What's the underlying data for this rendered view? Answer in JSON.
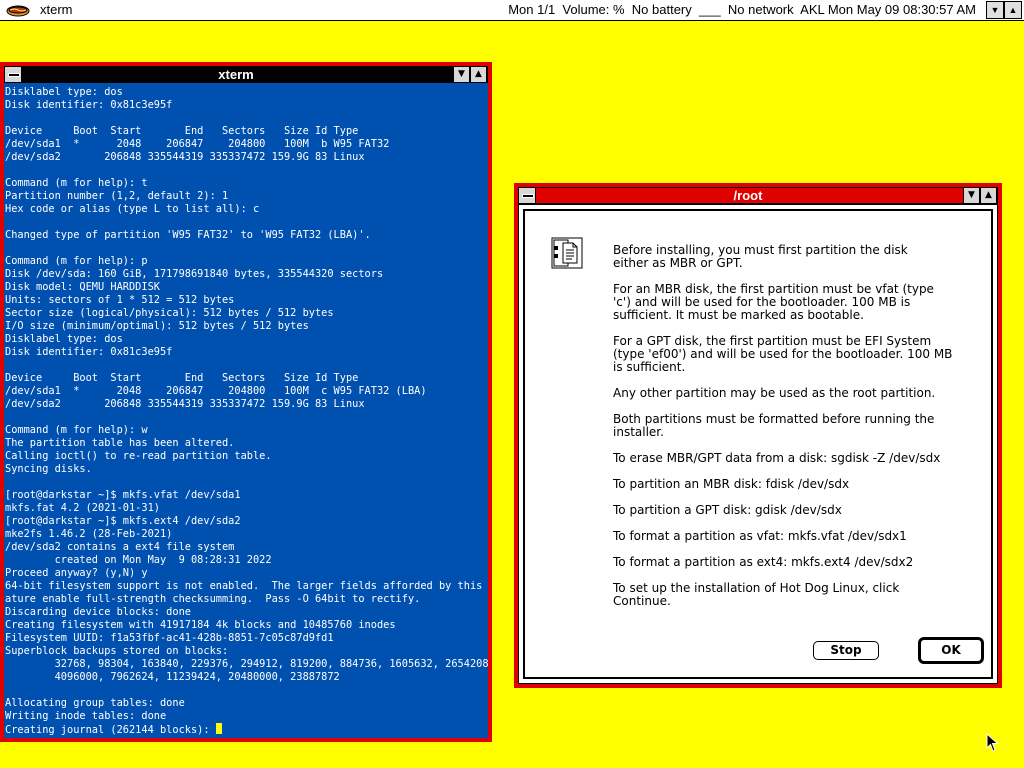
{
  "menubar": {
    "app_name": "xterm",
    "status": "Mon 1/1  Volume: %  No battery  ___  No network  AKL Mon May 09 08:30:57 AM",
    "colors": {
      "desktop": "#ffff00",
      "window_frame": "#e00000",
      "term_bg": "#0050b0"
    }
  },
  "xterm": {
    "title": "xterm",
    "lines": [
      "Disklabel type: dos",
      "Disk identifier: 0x81c3e95f",
      "",
      "Device     Boot  Start       End   Sectors   Size Id Type",
      "/dev/sda1  *      2048    206847    204800   100M  b W95 FAT32",
      "/dev/sda2       206848 335544319 335337472 159.9G 83 Linux",
      "",
      "Command (m for help): t",
      "Partition number (1,2, default 2): 1",
      "Hex code or alias (type L to list all): c",
      "",
      "Changed type of partition 'W95 FAT32' to 'W95 FAT32 (LBA)'.",
      "",
      "Command (m for help): p",
      "Disk /dev/sda: 160 GiB, 171798691840 bytes, 335544320 sectors",
      "Disk model: QEMU HARDDISK",
      "Units: sectors of 1 * 512 = 512 bytes",
      "Sector size (logical/physical): 512 bytes / 512 bytes",
      "I/O size (minimum/optimal): 512 bytes / 512 bytes",
      "Disklabel type: dos",
      "Disk identifier: 0x81c3e95f",
      "",
      "Device     Boot  Start       End   Sectors   Size Id Type",
      "/dev/sda1  *      2048    206847    204800   100M  c W95 FAT32 (LBA)",
      "/dev/sda2       206848 335544319 335337472 159.9G 83 Linux",
      "",
      "Command (m for help): w",
      "The partition table has been altered.",
      "Calling ioctl() to re-read partition table.",
      "Syncing disks.",
      "",
      "[root@darkstar ~]$ mkfs.vfat /dev/sda1",
      "mkfs.fat 4.2 (2021-01-31)",
      "[root@darkstar ~]$ mkfs.ext4 /dev/sda2",
      "mke2fs 1.46.2 (28-Feb-2021)",
      "/dev/sda2 contains a ext4 file system",
      "        created on Mon May  9 08:28:31 2022",
      "Proceed anyway? (y,N) y",
      "64-bit filesystem support is not enabled.  The larger fields afforded by this fe",
      "ature enable full-strength checksumming.  Pass -O 64bit to rectify.",
      "Discarding device blocks: done",
      "Creating filesystem with 41917184 4k blocks and 10485760 inodes",
      "Filesystem UUID: f1a53fbf-ac41-428b-8851-7c05c87d9fd1",
      "Superblock backups stored on blocks:",
      "        32768, 98304, 163840, 229376, 294912, 819200, 884736, 1605632, 2654208,",
      "        4096000, 7962624, 11239424, 20480000, 23887872",
      "",
      "Allocating group tables: done",
      "Writing inode tables: done",
      "Creating journal (262144 blocks): "
    ]
  },
  "dialog": {
    "title": "/root",
    "paragraphs": [
      "Before installing, you must first partition the disk\neither as MBR or GPT.",
      "For an MBR disk, the first partition must be vfat (type\n'c') and will be used for the bootloader. 100 MB is\nsufficient. It must be marked as bootable.",
      "For a GPT disk, the first partition must be EFI System\n(type 'ef00') and will be used for the bootloader. 100 MB\nis sufficient.",
      "Any other partition may be used as the root partition.",
      "Both partitions must be formatted before running the\ninstaller.",
      "To erase MBR/GPT data from a disk: sgdisk -Z /dev/sdx",
      "To partition an MBR disk: fdisk /dev/sdx",
      "To partition a GPT disk: gdisk /dev/sdx",
      "To format a partition as vfat: mkfs.vfat /dev/sdx1",
      "To format a partition as ext4: mkfs.ext4 /dev/sdx2",
      "To set up the installation of Hot Dog Linux, click\nContinue."
    ],
    "stop_label": "Stop",
    "ok_label": "OK"
  }
}
